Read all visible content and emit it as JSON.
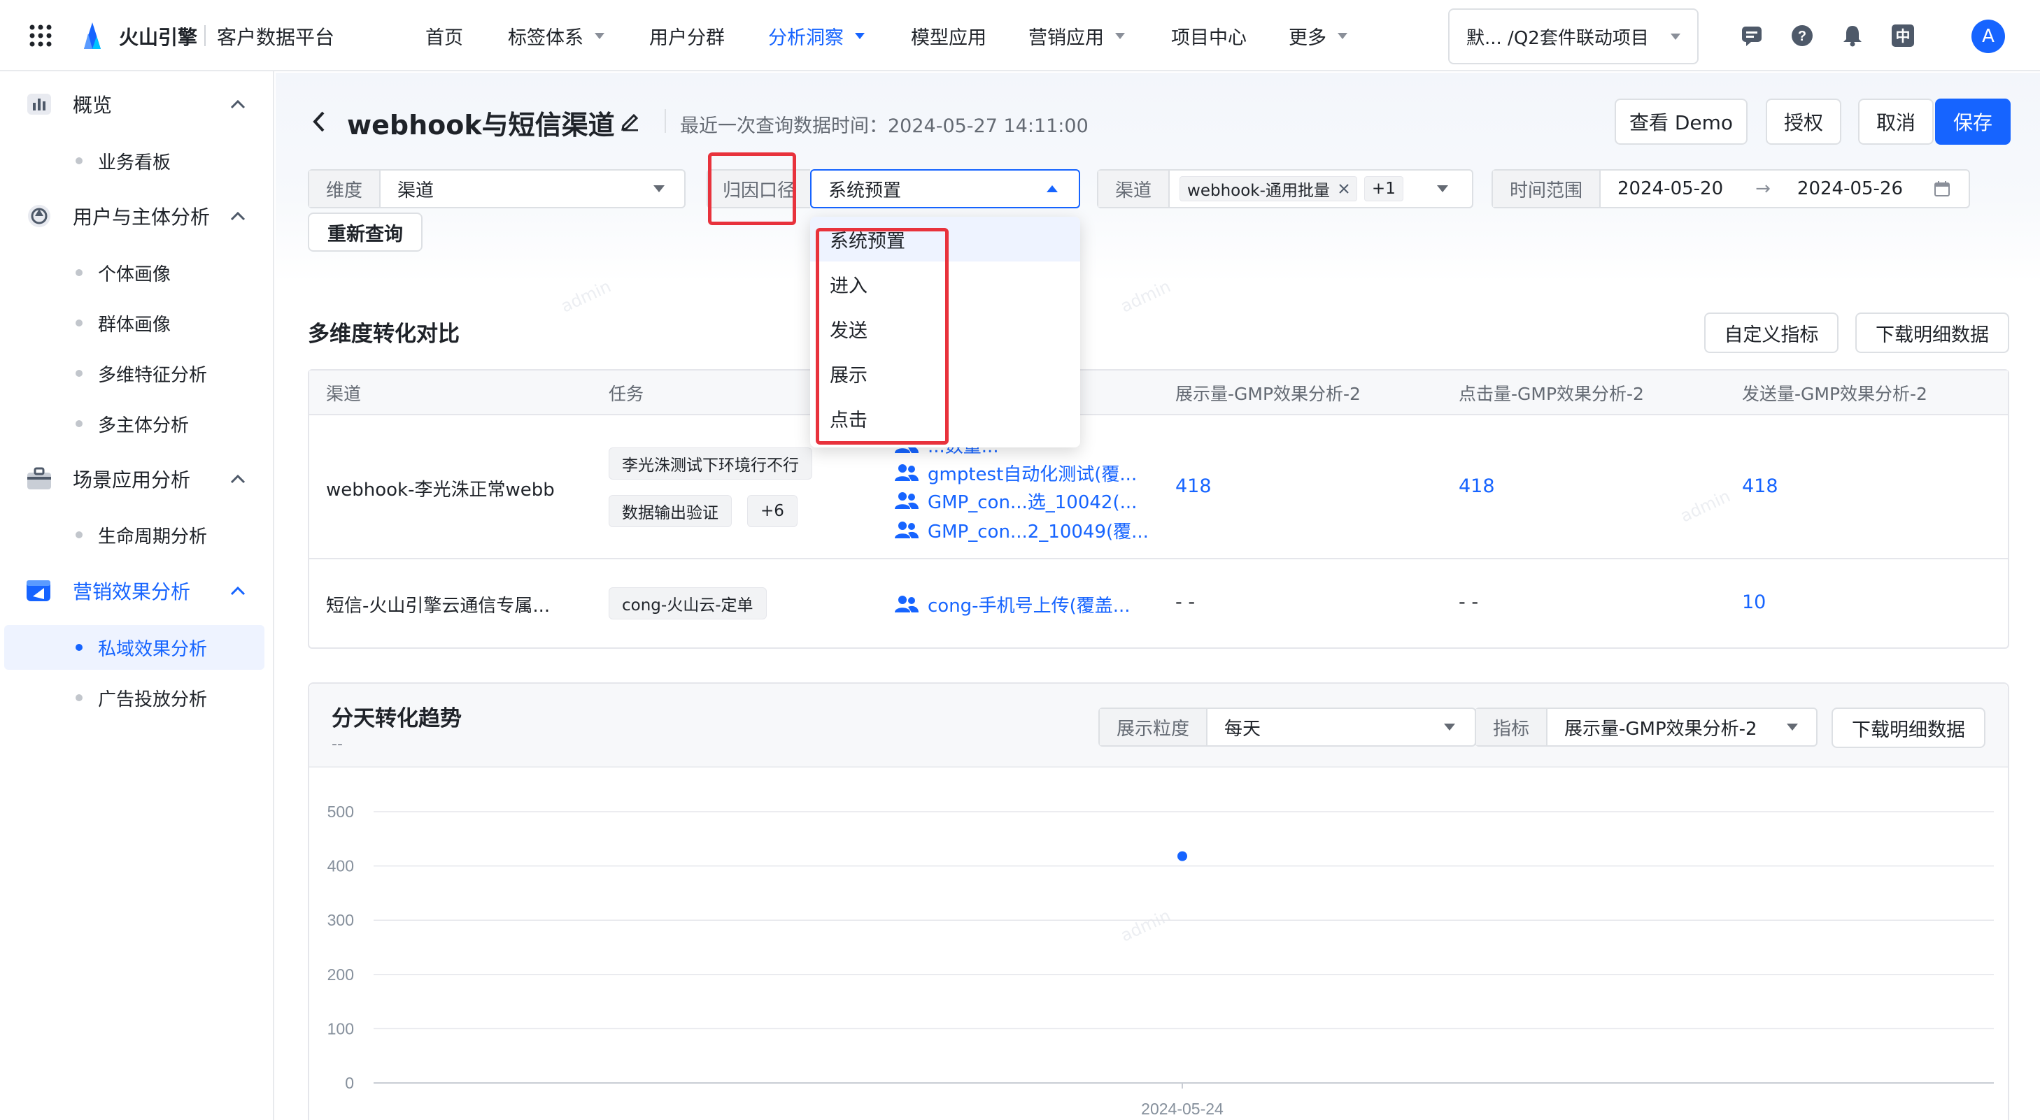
{
  "app": {
    "brand": "火山引擎",
    "product": "客户数据平台"
  },
  "nav": {
    "items": [
      {
        "label": "首页",
        "caret": false,
        "active": false
      },
      {
        "label": "标签体系",
        "caret": true,
        "active": false
      },
      {
        "label": "用户分群",
        "caret": false,
        "active": false
      },
      {
        "label": "分析洞察",
        "caret": true,
        "active": true
      },
      {
        "label": "模型应用",
        "caret": false,
        "active": false
      },
      {
        "label": "营销应用",
        "caret": true,
        "active": false
      },
      {
        "label": "项目中心",
        "caret": false,
        "active": false
      },
      {
        "label": "更多",
        "caret": true,
        "active": false
      }
    ],
    "project": "默... /Q2套件联动项目",
    "avatar": "A",
    "lang_icon": "中"
  },
  "sidebar": {
    "groups": [
      {
        "label": "概览",
        "icon": "bar-chart-icon",
        "items": [
          "业务看板"
        ]
      },
      {
        "label": "用户与主体分析",
        "icon": "aperture-icon",
        "items": [
          "个体画像",
          "群体画像",
          "多维特征分析",
          "多主体分析"
        ]
      },
      {
        "label": "场景应用分析",
        "icon": "briefcase-icon",
        "items": [
          "生命周期分析"
        ]
      },
      {
        "label": "营销效果分析",
        "icon": "megaphone-icon",
        "items": [
          "私域效果分析",
          "广告投放分析"
        ]
      }
    ],
    "active_item": "私域效果分析"
  },
  "page": {
    "title": "webhook与短信渠道",
    "last_query": "最近一次查询数据时间：2024-05-27 14:11:00",
    "buttons": {
      "demo": "查看 Demo",
      "auth": "授权",
      "cancel": "取消",
      "save": "保存"
    }
  },
  "filters": {
    "dimension": {
      "label": "维度",
      "value": "渠道"
    },
    "attribution": {
      "label": "归因口径",
      "value": "系统预置"
    },
    "channel": {
      "label": "渠道",
      "tag": "webhook-通用批量",
      "more": "+1"
    },
    "time": {
      "label": "时间范围",
      "start": "2024-05-20",
      "arrow": "→",
      "end": "2024-05-26"
    },
    "requery": "重新查询"
  },
  "dropdown": {
    "options": [
      "系统预置",
      "进入",
      "发送",
      "展示",
      "点击"
    ],
    "selected": "系统预置"
  },
  "compare": {
    "title": "多维度转化对比",
    "buttons": {
      "custom": "自定义指标",
      "download": "下载明细数据"
    },
    "columns": [
      "渠道",
      "任务",
      "展示量-GMP效果分析-2",
      "点击量-GMP效果分析-2",
      "发送量-GMP效果分析-2"
    ],
    "rows": [
      {
        "channel": "webhook-李光洙正常webb",
        "tasks": [
          "李光洙测试下环境行不行",
          "数据输出验证"
        ],
        "task_more": "+6",
        "groups": [
          "...数量...",
          "gmptest自动化测试(覆...",
          "GMP_con...选_10042(...",
          "GMP_con...2_10049(覆..."
        ],
        "show": "418",
        "click": "418",
        "send": "418"
      },
      {
        "channel": "短信-火山引擎云通信专属...",
        "tasks": [
          "cong-火山云-定单"
        ],
        "groups": [
          "cong-手机号上传(覆盖..."
        ],
        "show": "- -",
        "click": "- -",
        "send": "10"
      }
    ]
  },
  "trend": {
    "title": "分天转化趋势",
    "subtitle": "--",
    "granularity": {
      "label": "展示粒度",
      "value": "每天"
    },
    "metric": {
      "label": "指标",
      "value": "展示量-GMP效果分析-2"
    },
    "download": "下载明细数据"
  },
  "chart_data": {
    "type": "scatter",
    "x": [
      "2024-05-24"
    ],
    "series": [
      {
        "values": [
          418
        ]
      }
    ],
    "ylim": [
      0,
      500
    ],
    "yticks": [
      0,
      100,
      200,
      300,
      400,
      500
    ],
    "grid": true,
    "color": "#1664ff"
  },
  "watermark": "admin"
}
